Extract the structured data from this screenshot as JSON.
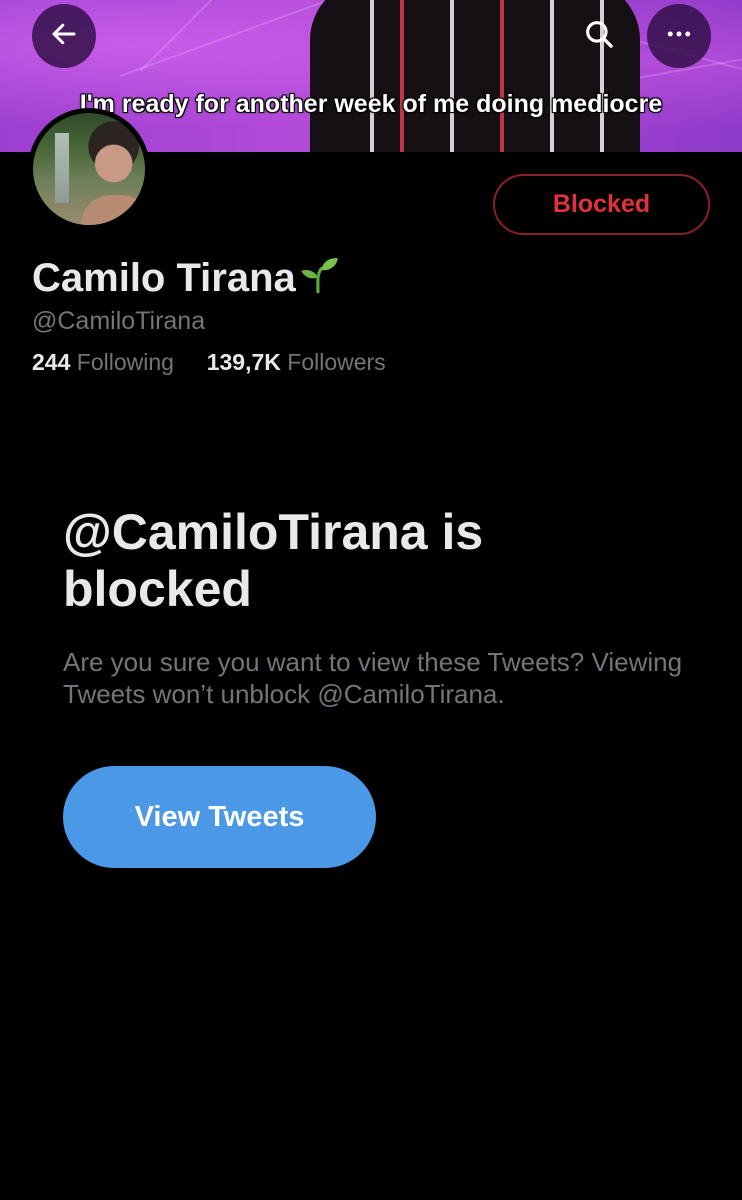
{
  "header": {
    "banner_caption": "I'm ready for another week of me doing mediocre",
    "back_icon": "arrow-left-icon",
    "search_icon": "search-icon",
    "more_icon": "more-horizontal-icon"
  },
  "profile": {
    "display_name": "Camilo Tirana",
    "name_emoji": "seedling-icon",
    "handle": "@CamiloTirana",
    "following_count": "244",
    "following_label": "Following",
    "followers_count": "139,7K",
    "followers_label": "Followers",
    "blocked_button_label": "Blocked"
  },
  "notice": {
    "title": "@CamiloTirana is blocked",
    "description": "Are you sure you want to view these Tweets? Viewing Tweets won’t unblock @CamiloTirana.",
    "view_button_label": "View Tweets"
  },
  "colors": {
    "background": "#000000",
    "blocked_red": "#e0313c",
    "accent_blue": "#4a98e6",
    "muted_text": "#71767b"
  }
}
